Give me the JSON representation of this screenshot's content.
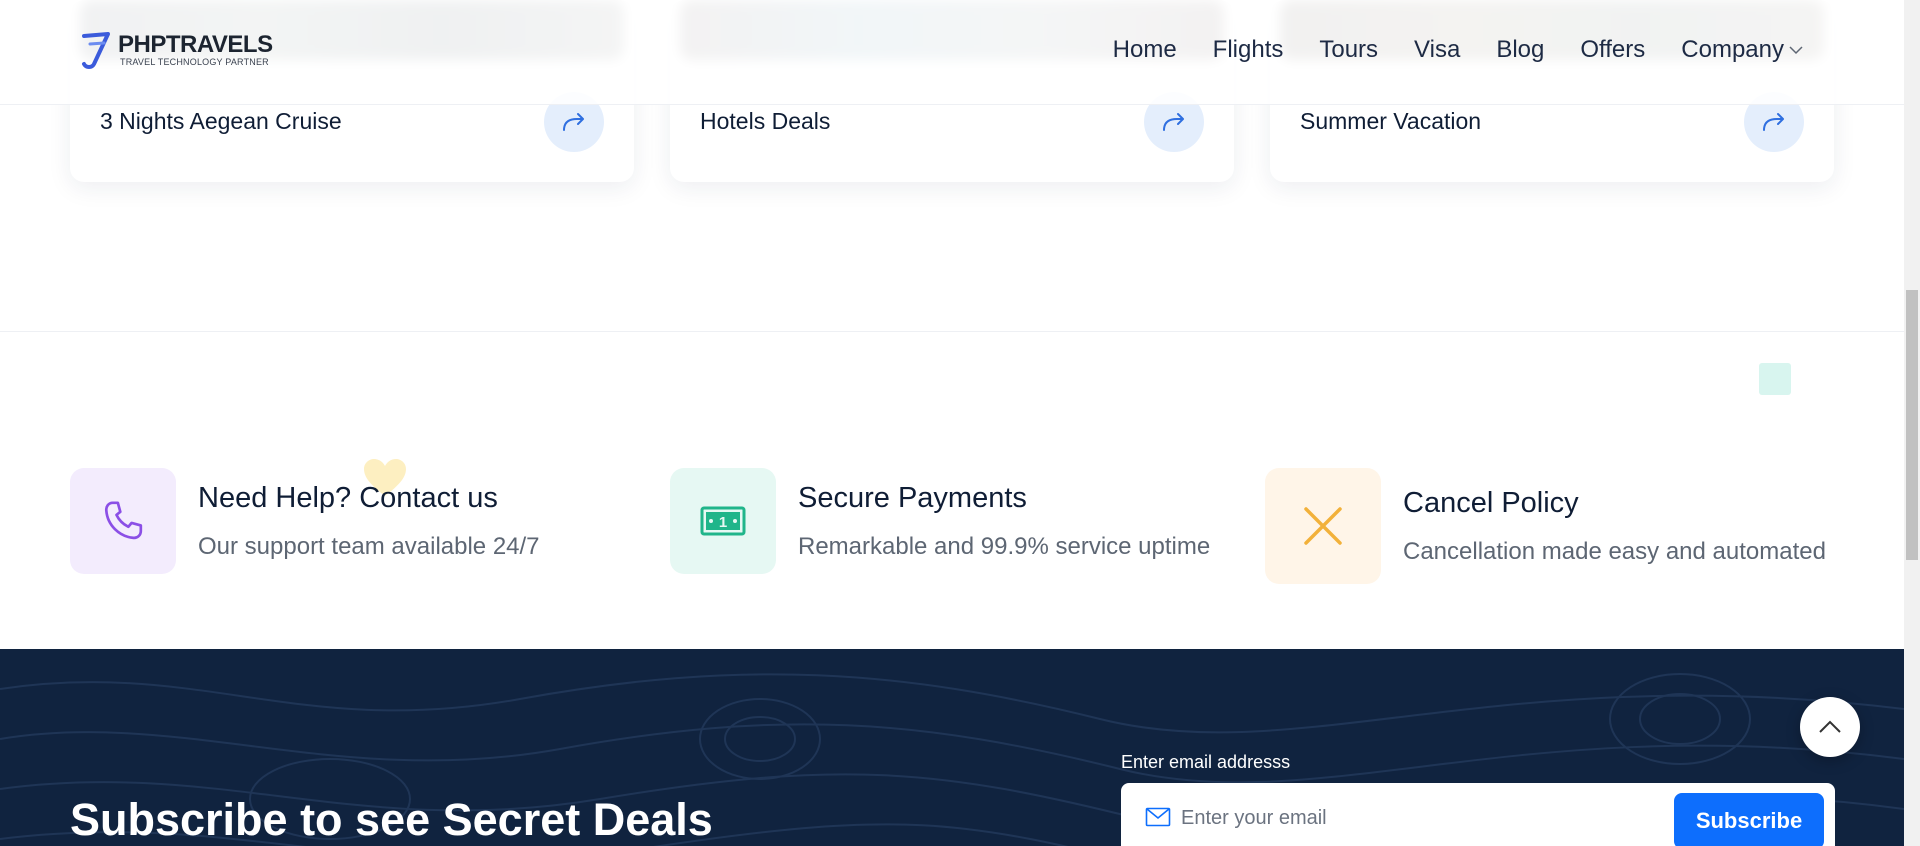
{
  "header": {
    "logo": {
      "name": "PHPTRAVELS",
      "tagline": "TRAVEL TECHNOLOGY PARTNER"
    },
    "nav": [
      {
        "label": "Home"
      },
      {
        "label": "Flights"
      },
      {
        "label": "Tours"
      },
      {
        "label": "Visa"
      },
      {
        "label": "Blog"
      },
      {
        "label": "Offers"
      },
      {
        "label": "Company",
        "has_dropdown": true
      }
    ]
  },
  "deals": [
    {
      "title": "3 Nights Aegean Cruise"
    },
    {
      "title": "Hotels Deals"
    },
    {
      "title": "Summer Vacation"
    }
  ],
  "features": [
    {
      "title": "Need Help? Contact us",
      "description": "Our support team available 24/7",
      "icon": "phone-icon",
      "bg": "#f3ecfd",
      "color": "#8b4fe6"
    },
    {
      "title": "Secure Payments",
      "description": "Remarkable and 99.9% service uptime",
      "icon": "money-icon",
      "bg": "#e6f8f3",
      "color": "#20b58a"
    },
    {
      "title": "Cancel Policy",
      "description": "Cancellation made easy and automated",
      "icon": "close-icon",
      "bg": "#fff5e8",
      "color": "#f2b13a"
    }
  ],
  "subscribe": {
    "title": "Subscribe to see Secret Deals",
    "label": "Enter email addresss",
    "placeholder": "Enter your email",
    "button": "Subscribe"
  },
  "colors": {
    "primary": "#0d6efd",
    "footer_bg": "#10233f",
    "text_dark": "#0f1d35",
    "text_muted": "#5d6673"
  }
}
